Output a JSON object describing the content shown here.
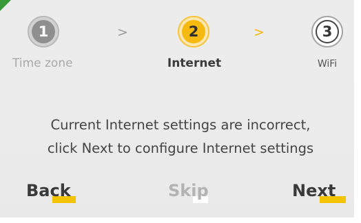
{
  "wizard": {
    "steps": [
      {
        "number": "1",
        "label": "Time zone",
        "state": "completed"
      },
      {
        "number": "2",
        "label": "Internet",
        "state": "current"
      },
      {
        "number": "3",
        "label": "WiFi",
        "state": "pending"
      }
    ],
    "separator_icon": "chevron-right-icon"
  },
  "message": {
    "line1": "Current Internet settings are incorrect,",
    "line2": "click Next to configure Internet settings"
  },
  "actions": {
    "back_label": "Back",
    "skip_label": "Skip",
    "next_label": "Next"
  },
  "colors": {
    "accent": "#f5b90f",
    "completed_step": "#8f8f8f",
    "background": "#ebebeb",
    "highlight": "#f5c400"
  }
}
